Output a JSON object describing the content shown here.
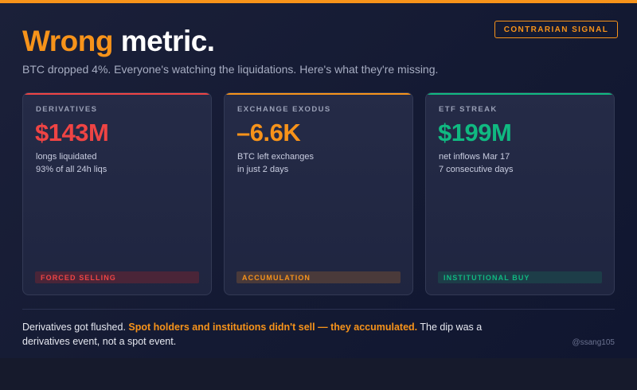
{
  "header": {
    "headline_accent": "Wrong",
    "headline_main": "metric.",
    "subtitle": "BTC dropped 4%. Everyone's watching the liquidations. Here's what they're missing.",
    "badge": "CONTRARIAN SIGNAL"
  },
  "colors": {
    "brand": "#f7931a",
    "red": "#ef4444",
    "orange": "#f7931a",
    "green": "#10b981",
    "background": "#161a2c"
  },
  "cards": [
    {
      "label": "DERIVATIVES",
      "value": "$143M",
      "desc1": "longs liquidated",
      "desc2": "93% of all 24h liqs",
      "tag": "FORCED SELLING",
      "accent": "#ef4444",
      "tag_bg": "#4a2538"
    },
    {
      "label": "EXCHANGE EXODUS",
      "value": "–6.6K",
      "desc1": "BTC left exchanges",
      "desc2": "in just 2 days",
      "tag": "ACCUMULATION",
      "accent": "#f7931a",
      "tag_bg": "#4a3a3a"
    },
    {
      "label": "ETF STREAK",
      "value": "$199M",
      "desc1": "net inflows Mar 17",
      "desc2": "7 consecutive days",
      "tag": "INSTITUTIONAL BUY",
      "accent": "#10b981",
      "tag_bg": "#1d3d48"
    }
  ],
  "summary": {
    "part1": "Derivatives got flushed. ",
    "highlight": "Spot holders and institutions didn't sell — they accumulated.",
    "part2": " The dip was a derivatives event, not a spot event."
  },
  "handle": "@ssang105"
}
